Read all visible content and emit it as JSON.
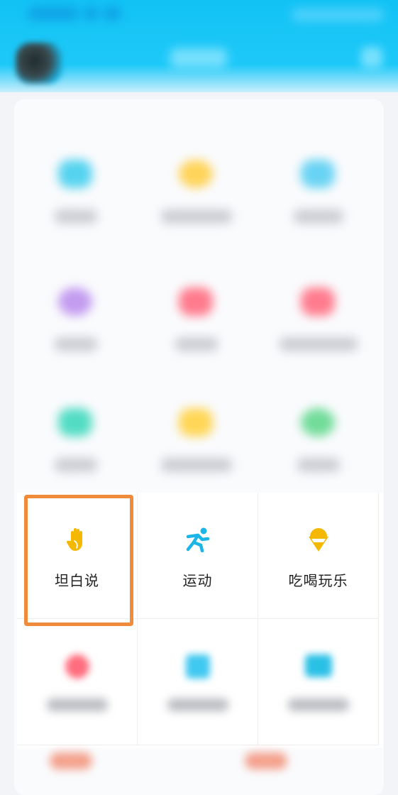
{
  "colors": {
    "header": "#12c2f5",
    "highlight": "#ef8b3a",
    "frank_icon": "#f5b800",
    "sport_icon": "#1bb5e8",
    "food_icon": "#f5b800"
  },
  "grid": {
    "row1": [
      {
        "label": "坦白说",
        "icon": "hand-icon"
      },
      {
        "label": "运动",
        "icon": "running-icon"
      },
      {
        "label": "吃喝玩乐",
        "icon": "ice-cream-icon"
      }
    ]
  }
}
